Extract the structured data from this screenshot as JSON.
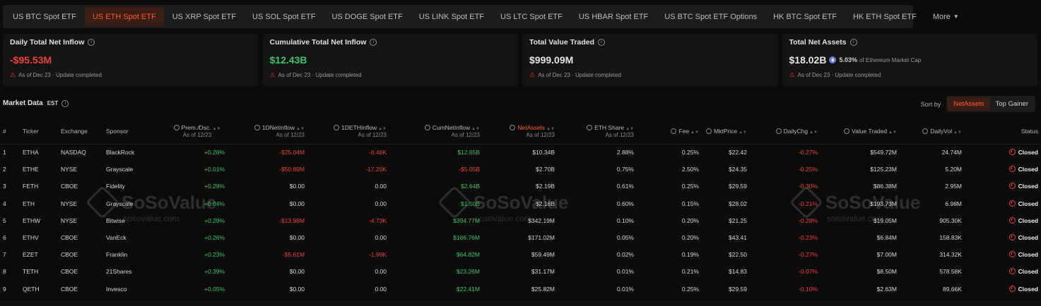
{
  "tabs": [
    {
      "label": "US BTC Spot ETF",
      "active": false
    },
    {
      "label": "US ETH Spot ETF",
      "active": true
    },
    {
      "label": "US XRP Spot ETF",
      "active": false
    },
    {
      "label": "US SOL Spot ETF",
      "active": false
    },
    {
      "label": "US DOGE Spot ETF",
      "active": false
    },
    {
      "label": "US LINK Spot ETF",
      "active": false
    },
    {
      "label": "US LTC Spot ETF",
      "active": false
    },
    {
      "label": "US HBAR Spot ETF",
      "active": false
    },
    {
      "label": "US BTC Spot ETF Options",
      "active": false
    },
    {
      "label": "HK BTC Spot ETF",
      "active": false
    },
    {
      "label": "HK ETH Spot ETF",
      "active": false
    },
    {
      "label": "More",
      "active": false
    }
  ],
  "cards": {
    "daily": {
      "title": "Daily Total Net Inflow",
      "value": "-$95.53M",
      "note": "As of Dec 23 · Update completed"
    },
    "cumulative": {
      "title": "Cumulative Total Net Inflow",
      "value": "$12.43B",
      "note": "As of Dec 23 · Update completed"
    },
    "traded": {
      "title": "Total Value Traded",
      "value": "$999.09M",
      "note": "As of Dec 23 · Update completed"
    },
    "assets": {
      "title": "Total Net Assets",
      "value": "$18.02B",
      "pct": "5.03%",
      "pct_note": "of Ethereum Market Cap",
      "note": "As of Dec 23 · Update completed"
    }
  },
  "market": {
    "title": "Market Data",
    "tz": "EST",
    "sort_label": "Sort by",
    "sort_options": [
      "NetAssets",
      "Top Gainer"
    ]
  },
  "columns": {
    "num": "#",
    "ticker": "Ticker",
    "exchange": "Exchange",
    "sponsor": "Sponsor",
    "prem": "Prem./Dsc.",
    "netinflow": "1DNetInflow",
    "ethinflow": "1DETHInflow",
    "cum": "CumNetInflow",
    "netassets": "NetAssets",
    "ethshare": "ETH Share",
    "fee": "Fee",
    "mkt": "MktPrice",
    "dchg": "DailyChg",
    "vt": "Value Traded",
    "dvol": "DailyVol",
    "status": "Status",
    "asof": "As of 12/23"
  },
  "rows": [
    {
      "n": "1",
      "ticker": "ETHA",
      "exchange": "NASDAQ",
      "sponsor": "BlackRock",
      "prem": "+0.26%",
      "netinflow": "-$25.04M",
      "ethinflow": "-8.46K",
      "cum": "$12.65B",
      "netassets": "$10.34B",
      "ethshare": "2.88%",
      "fee": "0.25%",
      "mkt": "$22.42",
      "dchg": "-0.27%",
      "vt": "$549.72M",
      "dvol": "24.74M",
      "status": "Closed"
    },
    {
      "n": "2",
      "ticker": "ETHE",
      "exchange": "NYSE",
      "sponsor": "Grayscale",
      "prem": "+0.01%",
      "netinflow": "-$50.89M",
      "ethinflow": "-17.20K",
      "cum": "-$5.05B",
      "netassets": "$2.70B",
      "ethshare": "0.75%",
      "fee": "2.50%",
      "mkt": "$24.35",
      "dchg": "-0.25%",
      "vt": "$125.23M",
      "dvol": "5.20M",
      "status": "Closed"
    },
    {
      "n": "3",
      "ticker": "FETH",
      "exchange": "CBOE",
      "sponsor": "Fidelity",
      "prem": "+0.29%",
      "netinflow": "$0.00",
      "ethinflow": "0.00",
      "cum": "$2.64B",
      "netassets": "$2.19B",
      "ethshare": "0.61%",
      "fee": "0.25%",
      "mkt": "$29.59",
      "dchg": "-0.30%",
      "vt": "$86.38M",
      "dvol": "2.95M",
      "status": "Closed"
    },
    {
      "n": "4",
      "ticker": "ETH",
      "exchange": "NYSE",
      "sponsor": "Grayscale",
      "prem": "+0.04%",
      "netinflow": "$0.00",
      "ethinflow": "0.00",
      "cum": "$1.50B",
      "netassets": "$2.16B",
      "ethshare": "0.60%",
      "fee": "0.15%",
      "mkt": "$28.02",
      "dchg": "-0.21%",
      "vt": "$193.73M",
      "dvol": "6.98M",
      "status": "Closed"
    },
    {
      "n": "5",
      "ticker": "ETHW",
      "exchange": "NYSE",
      "sponsor": "Bitwise",
      "prem": "+0.29%",
      "netinflow": "-$13.98M",
      "ethinflow": "-4.73K",
      "cum": "$394.77M",
      "netassets": "$342.19M",
      "ethshare": "0.10%",
      "fee": "0.20%",
      "mkt": "$21.25",
      "dchg": "-0.28%",
      "vt": "$19.05M",
      "dvol": "905.30K",
      "status": "Closed"
    },
    {
      "n": "6",
      "ticker": "ETHV",
      "exchange": "CBOE",
      "sponsor": "VanEck",
      "prem": "+0.26%",
      "netinflow": "$0.00",
      "ethinflow": "0.00",
      "cum": "$186.76M",
      "netassets": "$171.02M",
      "ethshare": "0.05%",
      "fee": "0.20%",
      "mkt": "$43.41",
      "dchg": "-0.23%",
      "vt": "$6.84M",
      "dvol": "158.83K",
      "status": "Closed"
    },
    {
      "n": "7",
      "ticker": "EZET",
      "exchange": "CBOE",
      "sponsor": "Franklin",
      "prem": "+0.23%",
      "netinflow": "-$5.61M",
      "ethinflow": "-1.90K",
      "cum": "$64.82M",
      "netassets": "$59.49M",
      "ethshare": "0.02%",
      "fee": "0.19%",
      "mkt": "$22.50",
      "dchg": "-0.27%",
      "vt": "$7.00M",
      "dvol": "314.32K",
      "status": "Closed"
    },
    {
      "n": "8",
      "ticker": "TETH",
      "exchange": "CBOE",
      "sponsor": "21Shares",
      "prem": "+0.39%",
      "netinflow": "$0.00",
      "ethinflow": "0.00",
      "cum": "$23.26M",
      "netassets": "$31.17M",
      "ethshare": "0.01%",
      "fee": "0.21%",
      "mkt": "$14.83",
      "dchg": "-0.07%",
      "vt": "$8.50M",
      "dvol": "578.58K",
      "status": "Closed"
    },
    {
      "n": "9",
      "ticker": "QETH",
      "exchange": "CBOE",
      "sponsor": "Invesco",
      "prem": "+0.05%",
      "netinflow": "$0.00",
      "ethinflow": "0.00",
      "cum": "$22.41M",
      "netassets": "$25.82M",
      "ethshare": "0.01%",
      "fee": "0.25%",
      "mkt": "$29.59",
      "dchg": "-0.10%",
      "vt": "$2.63M",
      "dvol": "89.66K",
      "status": "Closed"
    }
  ],
  "watermark": {
    "brand": "SoSoValue",
    "site": "sosovalue.com"
  },
  "colors": {
    "accent": "#ff5a2a",
    "negative": "#f0443f",
    "positive": "#3ec46d",
    "background": "#0b0b0b"
  }
}
